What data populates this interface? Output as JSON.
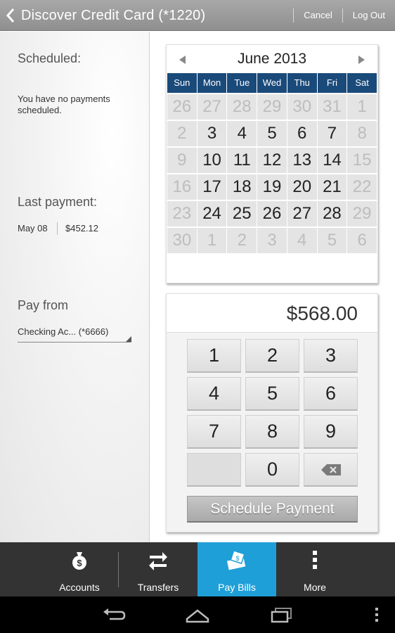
{
  "topbar": {
    "title": "Discover Credit Card (*1220)",
    "cancel_label": "Cancel",
    "logout_label": "Log Out"
  },
  "left": {
    "scheduled_title": "Scheduled:",
    "scheduled_message": "You have no payments scheduled.",
    "last_payment_title": "Last payment:",
    "last_payment_date": "May 08",
    "last_payment_amount": "$452.12",
    "pay_from_title": "Pay from",
    "pay_from_value": "Checking Ac...  (*6666)"
  },
  "calendar": {
    "title": "June 2013",
    "weekdays": [
      "Sun",
      "Mon",
      "Tue",
      "Wed",
      "Thu",
      "Fri",
      "Sat"
    ],
    "weeks": [
      [
        {
          "d": "26",
          "s": "muted"
        },
        {
          "d": "27",
          "s": "muted"
        },
        {
          "d": "28",
          "s": "muted"
        },
        {
          "d": "29",
          "s": "muted"
        },
        {
          "d": "30",
          "s": "muted"
        },
        {
          "d": "31",
          "s": "muted"
        },
        {
          "d": "1",
          "s": "disabled"
        }
      ],
      [
        {
          "d": "2",
          "s": "disabled"
        },
        {
          "d": "3",
          "s": "active"
        },
        {
          "d": "4",
          "s": "active"
        },
        {
          "d": "5",
          "s": "active"
        },
        {
          "d": "6",
          "s": "active"
        },
        {
          "d": "7",
          "s": "active"
        },
        {
          "d": "8",
          "s": "disabled"
        }
      ],
      [
        {
          "d": "9",
          "s": "disabled"
        },
        {
          "d": "10",
          "s": "active"
        },
        {
          "d": "11",
          "s": "active"
        },
        {
          "d": "12",
          "s": "active"
        },
        {
          "d": "13",
          "s": "active"
        },
        {
          "d": "14",
          "s": "active"
        },
        {
          "d": "15",
          "s": "disabled"
        }
      ],
      [
        {
          "d": "16",
          "s": "disabled"
        },
        {
          "d": "17",
          "s": "active"
        },
        {
          "d": "18",
          "s": "active"
        },
        {
          "d": "19",
          "s": "active"
        },
        {
          "d": "20",
          "s": "active"
        },
        {
          "d": "21",
          "s": "active"
        },
        {
          "d": "22",
          "s": "disabled"
        }
      ],
      [
        {
          "d": "23",
          "s": "disabled"
        },
        {
          "d": "24",
          "s": "active"
        },
        {
          "d": "25",
          "s": "active"
        },
        {
          "d": "26",
          "s": "active"
        },
        {
          "d": "27",
          "s": "active"
        },
        {
          "d": "28",
          "s": "active"
        },
        {
          "d": "29",
          "s": "disabled"
        }
      ],
      [
        {
          "d": "30",
          "s": "disabled"
        },
        {
          "d": "1",
          "s": "muted"
        },
        {
          "d": "2",
          "s": "muted"
        },
        {
          "d": "3",
          "s": "muted"
        },
        {
          "d": "4",
          "s": "muted"
        },
        {
          "d": "5",
          "s": "muted"
        },
        {
          "d": "6",
          "s": "muted"
        }
      ]
    ]
  },
  "keypad": {
    "amount": "$568.00",
    "keys": [
      "1",
      "2",
      "3",
      "4",
      "5",
      "6",
      "7",
      "8",
      "9",
      "",
      "0",
      "backspace"
    ],
    "schedule_label": "Schedule Payment"
  },
  "tabs": [
    {
      "label": "Accounts",
      "icon": "money-bag-icon",
      "active": false
    },
    {
      "label": "Transfers",
      "icon": "transfer-arrows-icon",
      "active": false
    },
    {
      "label": "Pay Bills",
      "icon": "pay-bills-icon",
      "active": true
    },
    {
      "label": "More",
      "icon": "more-dots-icon",
      "active": false
    }
  ],
  "colors": {
    "weekday_header": "#1a4a7a",
    "active_tab": "#1f9fd7",
    "tabbar": "#333333"
  }
}
